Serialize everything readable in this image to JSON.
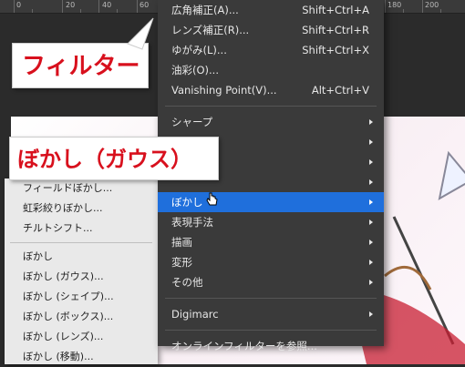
{
  "ruler": {
    "labels": [
      "0",
      "20",
      "40",
      "60",
      "180",
      "200"
    ]
  },
  "callouts": {
    "filter": "フィルター",
    "blur_gaussian": "ぼかし（ガウス）"
  },
  "submenu": {
    "items": [
      "フィールドぼかし...",
      "虹彩絞りぼかし...",
      "チルトシフト...",
      "ぼかし",
      "ぼかし (ガウス)...",
      "ぼかし (シェイプ)...",
      "ぼかし (ボックス)...",
      "ぼかし (レンズ)...",
      "ぼかし (移動)..."
    ]
  },
  "menu": {
    "top_items": [
      {
        "label": "広角補正(A)...",
        "shortcut": "Shift+Ctrl+A"
      },
      {
        "label": "レンズ補正(R)...",
        "shortcut": "Shift+Ctrl+R"
      },
      {
        "label": "ゆがみ(L)...",
        "shortcut": "Shift+Ctrl+X"
      },
      {
        "label": "油彩(O)...",
        "shortcut": ""
      },
      {
        "label": "Vanishing Point(V)...",
        "shortcut": "Alt+Ctrl+V"
      }
    ],
    "submenus": [
      "シャープ",
      "",
      "",
      "",
      "ぼかし",
      "表現手法",
      "描画",
      "変形",
      "その他"
    ],
    "digimarc": "Digimarc",
    "online": "オンラインフィルターを参照..."
  },
  "colors": {
    "highlight": "#1f6fdc",
    "callout_text": "#d8101d"
  }
}
